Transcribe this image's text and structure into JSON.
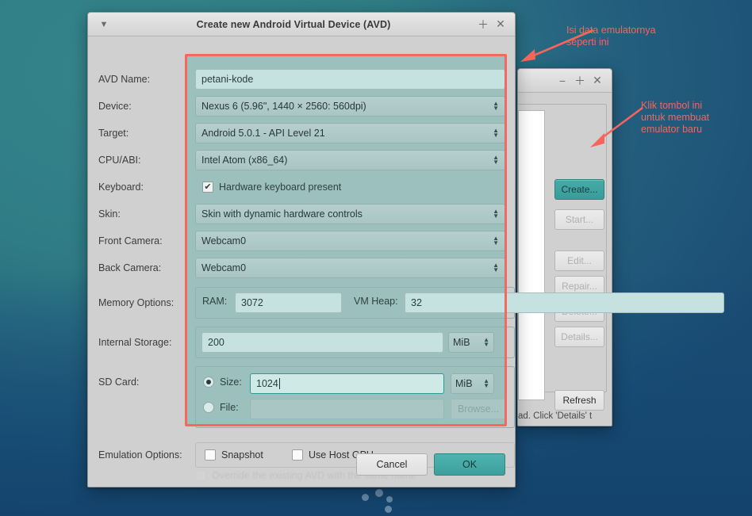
{
  "desktop": {
    "background_top_color": "#2f7f86",
    "background_bottom_color": "#174a72",
    "dots_label": "decorative-dots"
  },
  "dialog": {
    "title": "Create new Android Virtual Device (AVD)",
    "menu_icon": "▼",
    "maximize_icon": "＋",
    "close_icon": "✕",
    "highlight_color": "#f4695f",
    "fields": {
      "avd_name": {
        "label": "AVD Name:",
        "value": "petani-kode"
      },
      "device": {
        "label": "Device:",
        "value": "Nexus 6 (5.96\", 1440 × 2560: 560dpi)"
      },
      "target": {
        "label": "Target:",
        "value": "Android 5.0.1 - API Level 21"
      },
      "cpu_abi": {
        "label": "CPU/ABI:",
        "value": "Intel Atom (x86_64)"
      },
      "keyboard": {
        "label": "Keyboard:",
        "checkbox_label": "Hardware keyboard present",
        "checked": true,
        "check_glyph": "✔"
      },
      "skin": {
        "label": "Skin:",
        "value": "Skin with dynamic hardware controls"
      },
      "front_camera": {
        "label": "Front Camera:",
        "value": "Webcam0"
      },
      "back_camera": {
        "label": "Back Camera:",
        "value": "Webcam0"
      },
      "memory_options": {
        "label": "Memory Options:",
        "ram_label": "RAM:",
        "ram_value": "3072",
        "vmheap_label": "VM Heap:",
        "vmheap_value": "32"
      },
      "internal_storage": {
        "label": "Internal Storage:",
        "value": "200",
        "unit": "MiB"
      },
      "sd_card": {
        "label": "SD Card:",
        "size_radio_label": "Size:",
        "size_value": "1024",
        "size_unit": "MiB",
        "size_selected": true,
        "file_radio_label": "File:",
        "file_value": "",
        "browse_label": "Browse..."
      },
      "emulation_options": {
        "label": "Emulation Options:",
        "snapshot_label": "Snapshot",
        "snapshot_checked": false,
        "host_gpu_label": "Use Host GPU",
        "host_gpu_checked": false
      },
      "override_row": {
        "label": "Override the existing AVD with the same name"
      }
    },
    "buttons": {
      "cancel": "Cancel",
      "ok": "OK"
    }
  },
  "background_window": {
    "minimize_icon": "−",
    "maximize_icon": "＋",
    "close_icon": "✕",
    "buttons": [
      {
        "name": "create",
        "label": "Create...",
        "state": "primary"
      },
      {
        "name": "start",
        "label": "Start...",
        "state": "disabled"
      },
      {
        "name": "edit",
        "label": "Edit...",
        "state": "disabled"
      },
      {
        "name": "repair",
        "label": "Repair...",
        "state": "disabled"
      },
      {
        "name": "delete",
        "label": "Delete...",
        "state": "disabled"
      },
      {
        "name": "details",
        "label": "Details...",
        "state": "disabled"
      },
      {
        "name": "refresh",
        "label": "Refresh",
        "state": "enabled"
      }
    ],
    "status_text": "ad. Click 'Details' t"
  },
  "annotations": [
    {
      "name": "fill-data-note",
      "text": "Isi data emulatornya\nseperti ini",
      "color": "#f4655c"
    },
    {
      "name": "click-create-note",
      "text": "Klik tombol ini\nuntuk membuat\nemulator baru",
      "color": "#f4655c"
    }
  ]
}
